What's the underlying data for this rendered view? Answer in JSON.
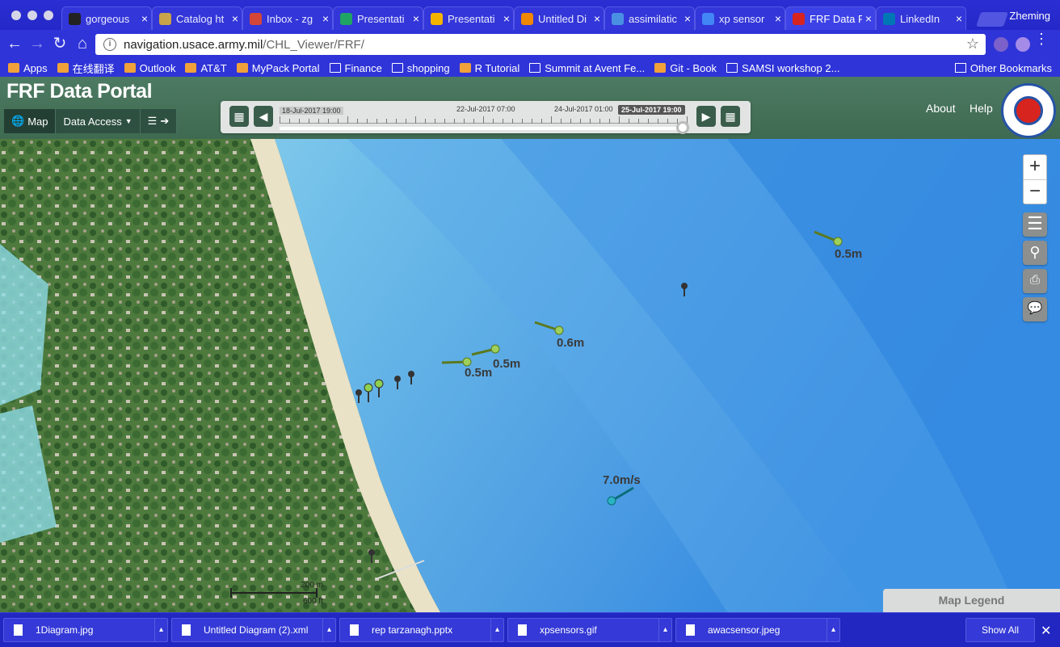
{
  "browser": {
    "tabs": [
      {
        "label": "gorgeous",
        "favicon": "github-icon",
        "color": "#222222"
      },
      {
        "label": "Catalog ht",
        "favicon": "page-icon",
        "color": "#c7a34a"
      },
      {
        "label": "Inbox - zg",
        "favicon": "gmail-icon",
        "color": "#d44638"
      },
      {
        "label": "Presentati",
        "favicon": "drive-icon",
        "color": "#1fa463"
      },
      {
        "label": "Presentati",
        "favicon": "slides-icon",
        "color": "#f4b400"
      },
      {
        "label": "Untitled Di",
        "favicon": "drawio-icon",
        "color": "#f08705"
      },
      {
        "label": "assimilatic",
        "favicon": "image-search-icon",
        "color": "#4a90e2"
      },
      {
        "label": "xp sensor",
        "favicon": "google-icon",
        "color": "#4285f4"
      },
      {
        "label": "FRF Data P",
        "favicon": "usace-icon",
        "color": "#d7241f",
        "active": true
      },
      {
        "label": "LinkedIn",
        "favicon": "linkedin-icon",
        "color": "#0077b5"
      }
    ],
    "profile": "Zheming",
    "url_host": "navigation.usace.army.mil",
    "url_path": "/CHL_Viewer/FRF/",
    "bookmarks": [
      {
        "label": "Apps",
        "icon": "apps-grid-icon"
      },
      {
        "label": "在线翻译",
        "icon": "translate-icon"
      },
      {
        "label": "Outlook",
        "icon": "outlook-icon"
      },
      {
        "label": "AT&T",
        "icon": "att-icon"
      },
      {
        "label": "MyPack Portal",
        "icon": "mypack-icon"
      },
      {
        "label": "Finance",
        "icon": "folder-icon"
      },
      {
        "label": "shopping",
        "icon": "folder-icon"
      },
      {
        "label": "R Tutorial",
        "icon": "r-icon"
      },
      {
        "label": "Summit at Avent Fe...",
        "icon": "folder-icon"
      },
      {
        "label": "Git - Book",
        "icon": "git-icon"
      },
      {
        "label": "SAMSI workshop 2...",
        "icon": "folder-icon"
      }
    ],
    "other_bookmarks": "Other Bookmarks"
  },
  "portal": {
    "title": "FRF Data Portal",
    "nav": {
      "map": "Map",
      "data_access": "Data Access"
    },
    "about": "About",
    "help": "Help",
    "timeline": {
      "start": "18-Jul-2017 19:00",
      "mid1": "22-Jul-2017 07:00",
      "mid2": "24-Jul-2017 01:00",
      "current": "25-Jul-2017 19:00",
      "position": 1.0
    }
  },
  "map": {
    "labels": {
      "wave1": "0.5m",
      "wave2": "0.6m",
      "wave3": "0.5m",
      "wave4": "0.5m",
      "wind": "7.0m/s"
    },
    "scale": {
      "meters": "200 m",
      "feet": "600 ft"
    },
    "legend": "Map Legend"
  },
  "downloads": {
    "items": [
      "1Diagram.jpg",
      "Untitled Diagram (2).xml",
      "rep tarzanagh.pptx",
      "xpsensors.gif",
      "awacsensor.jpeg"
    ],
    "show_all": "Show All"
  }
}
